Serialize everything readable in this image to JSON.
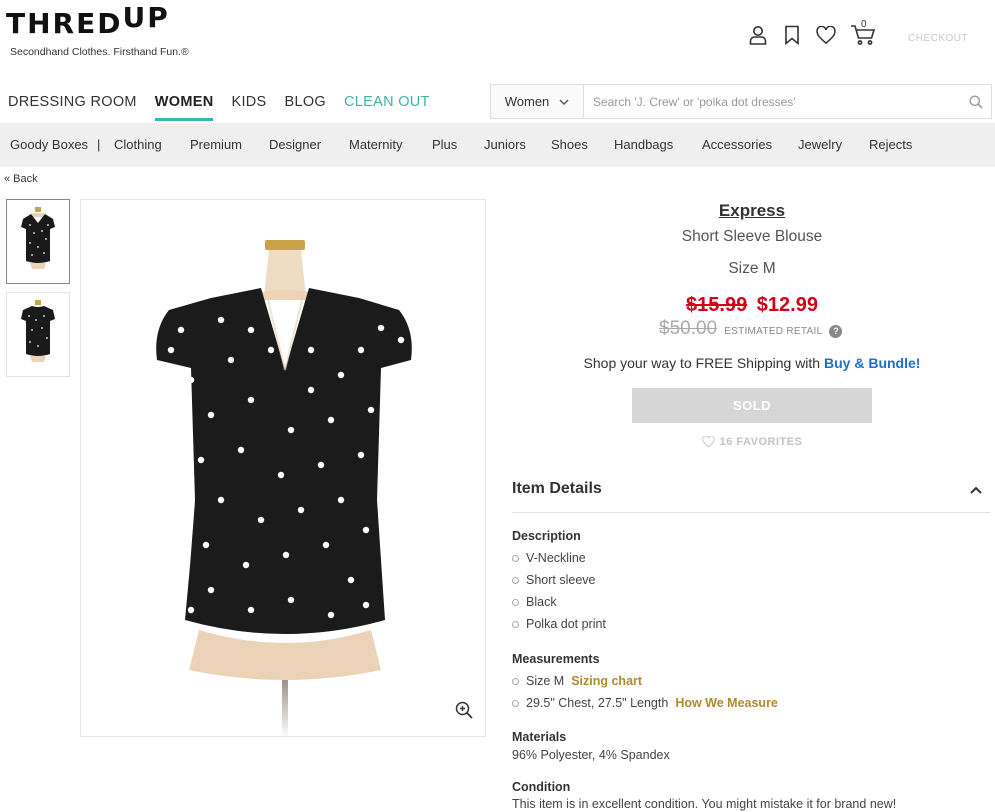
{
  "header": {
    "logo_main": "THRED",
    "logo_up": "UP",
    "tagline": "Secondhand Clothes. Firsthand Fun.®",
    "cart_count": "0",
    "checkout_label": "CHECKOUT"
  },
  "mainnav": [
    {
      "label": "DRESSING ROOM"
    },
    {
      "label": "WOMEN"
    },
    {
      "label": "KIDS"
    },
    {
      "label": "BLOG"
    },
    {
      "label": "CLEAN OUT"
    }
  ],
  "search": {
    "category": "Women",
    "placeholder": "Search 'J. Crew' or 'polka dot dresses'"
  },
  "categories": [
    {
      "label": "Goody Boxes"
    },
    {
      "label": "Clothing"
    },
    {
      "label": "Premium"
    },
    {
      "label": "Designer"
    },
    {
      "label": "Maternity"
    },
    {
      "label": "Plus"
    },
    {
      "label": "Juniors"
    },
    {
      "label": "Shoes"
    },
    {
      "label": "Handbags"
    },
    {
      "label": "Accessories"
    },
    {
      "label": "Jewelry"
    },
    {
      "label": "Rejects"
    }
  ],
  "category_separator": "|",
  "back_label": "« Back",
  "product": {
    "brand": "Express",
    "name": "Short Sleeve Blouse",
    "size": "Size M",
    "original_price": "$15.99",
    "sale_price": "$12.99",
    "retail_price": "$50.00",
    "retail_label": "ESTIMATED RETAIL",
    "retail_help": "?",
    "shipping_text": "Shop your way to FREE Shipping with ",
    "shipping_link": "Buy & Bundle!",
    "sold_label": "SOLD",
    "favorites": "16 FAVORITES"
  },
  "details": {
    "title": "Item Details",
    "description_title": "Description",
    "description": [
      "V-Neckline",
      "Short sleeve",
      "Black",
      "Polka dot print"
    ],
    "measurements_title": "Measurements",
    "measurement_size": "Size M",
    "sizing_chart": "Sizing chart",
    "measurement_dims": "29.5\" Chest, 27.5\" Length",
    "how_we_measure": "How We Measure",
    "materials_title": "Materials",
    "materials": "96% Polyester, 4% Spandex",
    "condition_title": "Condition",
    "condition": "This item is in excellent condition. You might mistake it for brand new!"
  },
  "colors": {
    "accent_teal": "#3ab5a9",
    "price_red": "#d0021b",
    "link_blue": "#1f6fc9",
    "link_gold": "#b08a2e"
  }
}
